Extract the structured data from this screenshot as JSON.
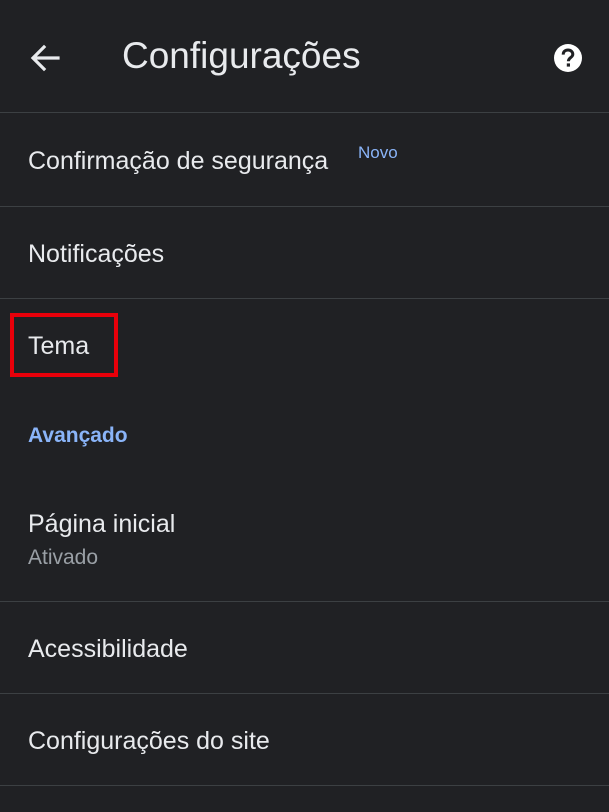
{
  "header": {
    "title": "Configurações",
    "back_icon": "arrow-back-icon",
    "help_icon": "help-circle-icon"
  },
  "colors": {
    "background": "#202124",
    "text_primary": "#e8eaed",
    "text_secondary": "#9aa0a6",
    "accent": "#8ab4f8",
    "divider": "#3c4043",
    "highlight": "#e8000a"
  },
  "items": {
    "security_check": {
      "label": "Confirmação de segurança",
      "badge": "Novo"
    },
    "notifications": {
      "label": "Notificações"
    },
    "theme": {
      "label": "Tema"
    },
    "advanced_header": "Avançado",
    "homepage": {
      "label": "Página inicial",
      "status": "Ativado"
    },
    "accessibility": {
      "label": "Acessibilidade"
    },
    "site_settings": {
      "label": "Configurações do site"
    }
  }
}
